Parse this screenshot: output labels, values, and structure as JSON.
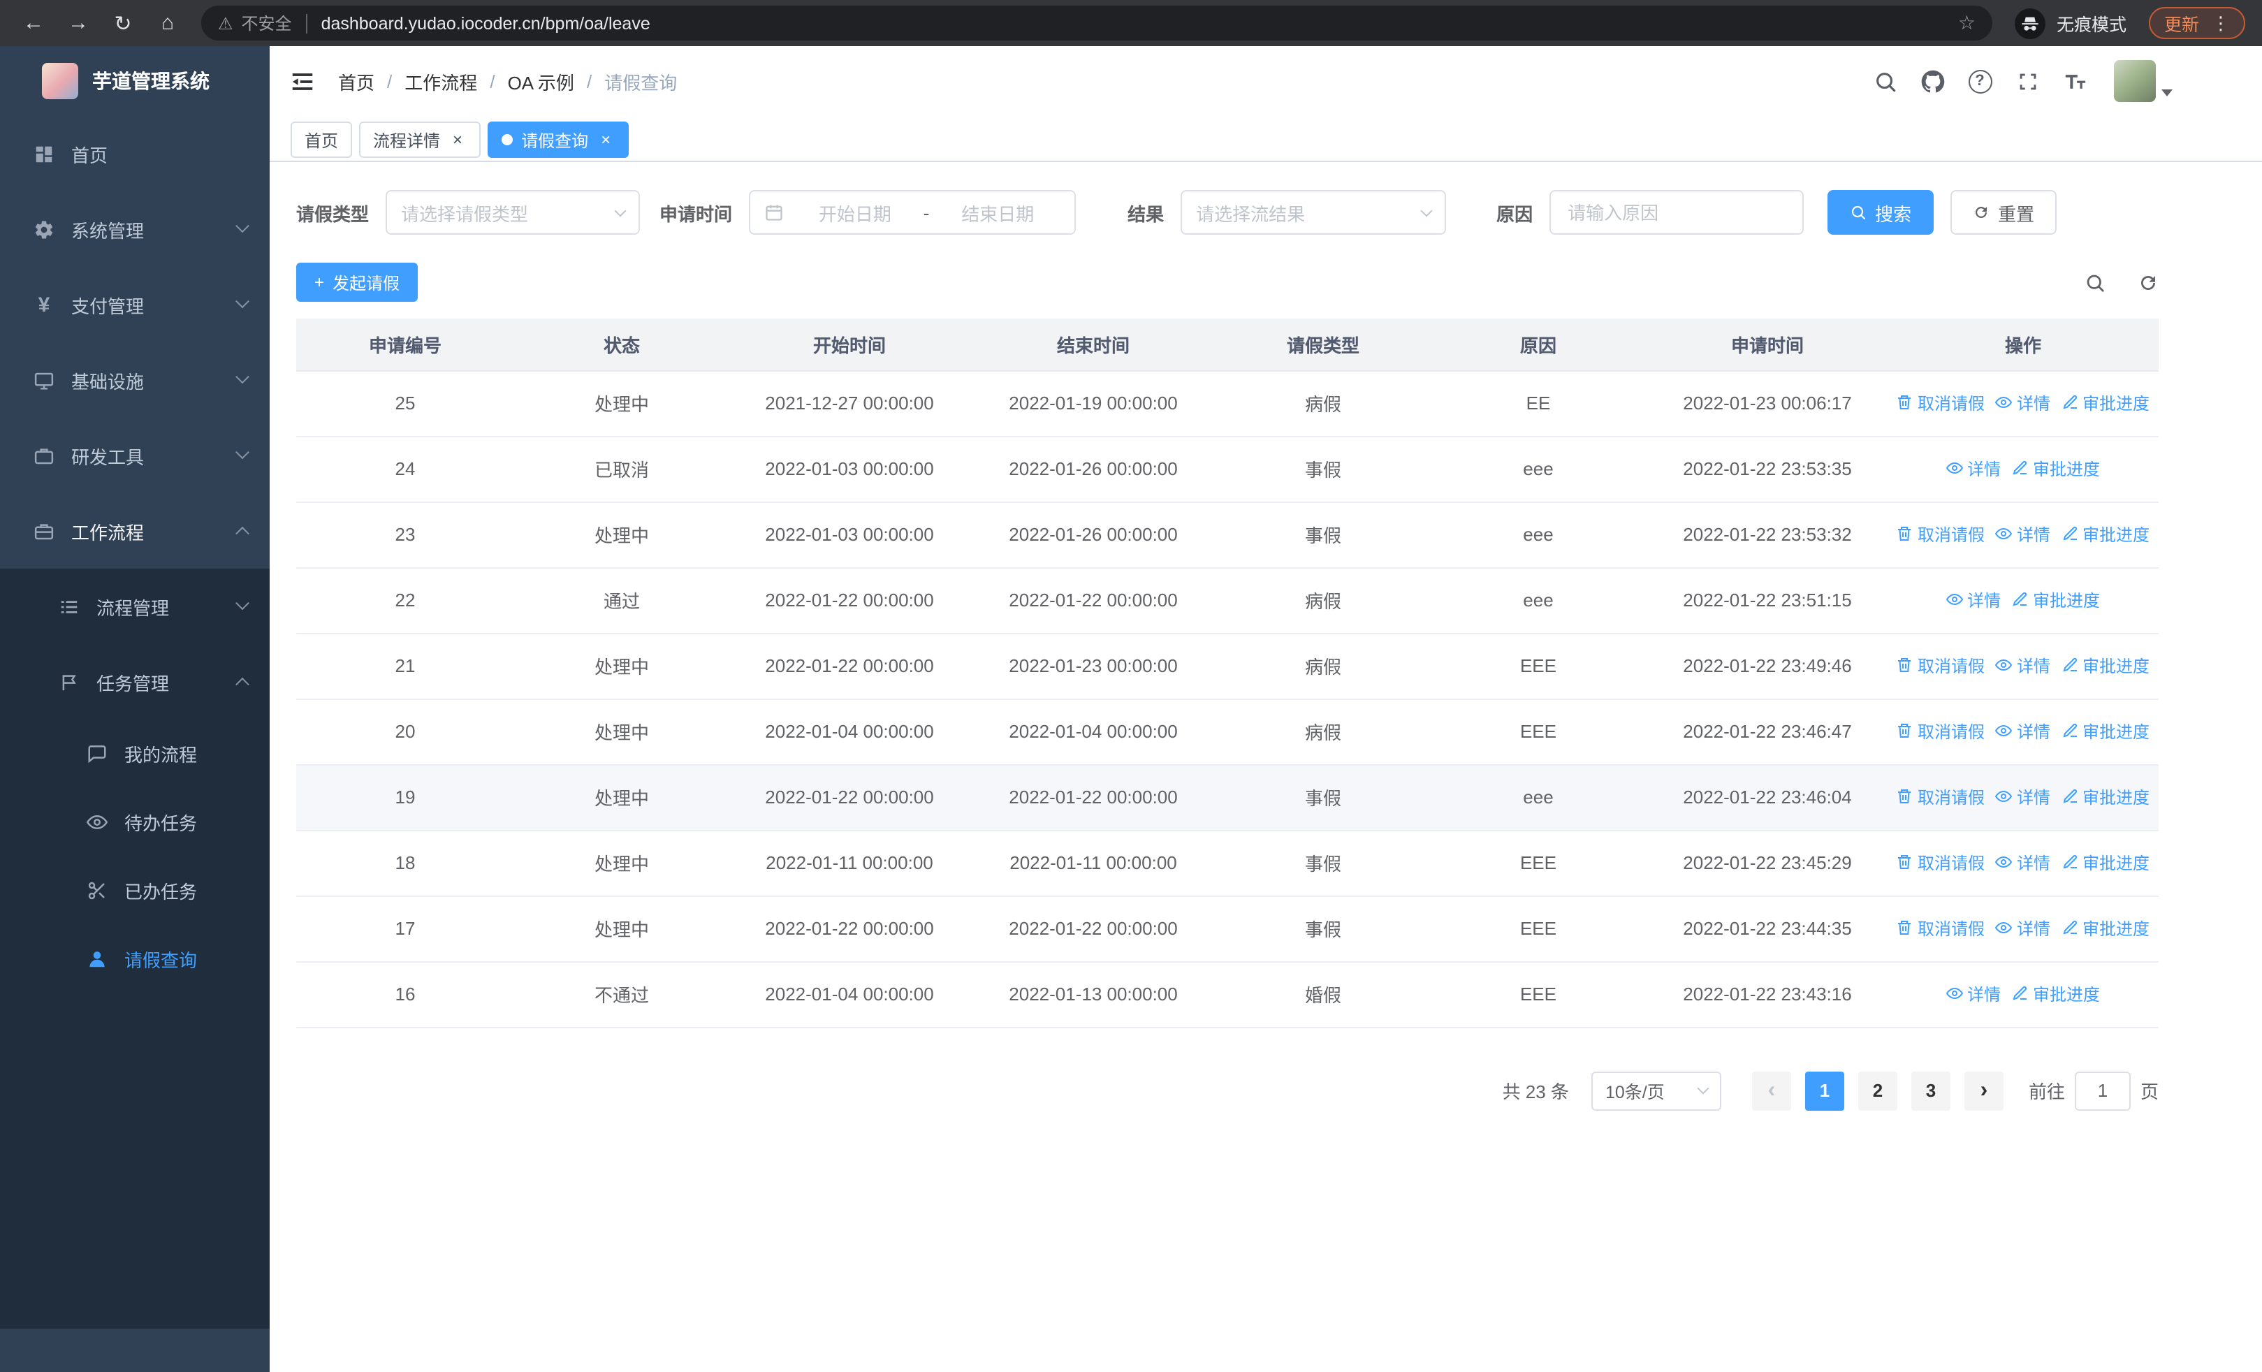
{
  "icons": {
    "back": "←",
    "forward": "→",
    "reload": "↻",
    "home": "⌂",
    "warning": "⚠",
    "star": "☆",
    "dots": "⋮",
    "plus": "+",
    "question": "?",
    "slash": "/",
    "close": "×",
    "prev": "‹",
    "next": "›",
    "yen": "¥"
  },
  "browser": {
    "security_label": "不安全",
    "url": "dashboard.yudao.iocoder.cn/bpm/oa/leave",
    "incognito_label": "无痕模式",
    "update_label": "更新"
  },
  "sidebar": {
    "logo_title": "芋道管理系统",
    "items": [
      {
        "label": "首页",
        "icon": "dashboard-icon"
      },
      {
        "label": "系统管理",
        "icon": "gear-icon"
      },
      {
        "label": "支付管理",
        "icon": "payment-icon"
      },
      {
        "label": "基础设施",
        "icon": "infrastructure-icon"
      },
      {
        "label": "研发工具",
        "icon": "tools-icon"
      },
      {
        "label": "工作流程",
        "icon": "workflow-icon"
      }
    ],
    "sub_items": [
      {
        "label": "流程管理",
        "icon": "process-management-icon"
      },
      {
        "label": "任务管理",
        "icon": "task-management-icon"
      }
    ],
    "task_items": [
      {
        "label": "我的流程",
        "icon": "my-process-icon"
      },
      {
        "label": "待办任务",
        "icon": "todo-tasks-icon"
      },
      {
        "label": "已办任务",
        "icon": "completed-tasks-icon"
      },
      {
        "label": "请假查询",
        "icon": "leave-query-icon"
      }
    ]
  },
  "header": {
    "breadcrumb": [
      "首页",
      "工作流程",
      "OA 示例",
      "请假查询"
    ]
  },
  "tabs": [
    {
      "label": "首页"
    },
    {
      "label": "流程详情"
    },
    {
      "label": "请假查询"
    }
  ],
  "filters": {
    "leave_type_label": "请假类型",
    "leave_type_placeholder": "请选择请假类型",
    "apply_time_label": "申请时间",
    "start_date_placeholder": "开始日期",
    "date_separator": "-",
    "end_date_placeholder": "结束日期",
    "result_label": "结果",
    "result_placeholder": "请选择流结果",
    "reason_label": "原因",
    "reason_placeholder": "请输入原因",
    "search_label": "搜索",
    "reset_label": "重置"
  },
  "toolbar": {
    "create_label": "发起请假"
  },
  "table": {
    "columns": [
      "申请编号",
      "状态",
      "开始时间",
      "结束时间",
      "请假类型",
      "原因",
      "申请时间",
      "操作"
    ],
    "action_labels": {
      "cancel": "取消请假",
      "detail": "详情",
      "progress": "审批进度"
    },
    "rows": [
      {
        "id": "25",
        "status": "处理中",
        "start": "2021-12-27 00:00:00",
        "end": "2022-01-19 00:00:00",
        "type": "病假",
        "reason": "EE",
        "applied": "2022-01-23 00:06:17",
        "actions": [
          "cancel",
          "detail",
          "progress"
        ],
        "highlight": false
      },
      {
        "id": "24",
        "status": "已取消",
        "start": "2022-01-03 00:00:00",
        "end": "2022-01-26 00:00:00",
        "type": "事假",
        "reason": "eee",
        "applied": "2022-01-22 23:53:35",
        "actions": [
          "detail",
          "progress"
        ],
        "highlight": false
      },
      {
        "id": "23",
        "status": "处理中",
        "start": "2022-01-03 00:00:00",
        "end": "2022-01-26 00:00:00",
        "type": "事假",
        "reason": "eee",
        "applied": "2022-01-22 23:53:32",
        "actions": [
          "cancel",
          "detail",
          "progress"
        ],
        "highlight": false
      },
      {
        "id": "22",
        "status": "通过",
        "start": "2022-01-22 00:00:00",
        "end": "2022-01-22 00:00:00",
        "type": "病假",
        "reason": "eee",
        "applied": "2022-01-22 23:51:15",
        "actions": [
          "detail",
          "progress"
        ],
        "highlight": false
      },
      {
        "id": "21",
        "status": "处理中",
        "start": "2022-01-22 00:00:00",
        "end": "2022-01-23 00:00:00",
        "type": "病假",
        "reason": "EEE",
        "applied": "2022-01-22 23:49:46",
        "actions": [
          "cancel",
          "detail",
          "progress"
        ],
        "highlight": false
      },
      {
        "id": "20",
        "status": "处理中",
        "start": "2022-01-04 00:00:00",
        "end": "2022-01-04 00:00:00",
        "type": "病假",
        "reason": "EEE",
        "applied": "2022-01-22 23:46:47",
        "actions": [
          "cancel",
          "detail",
          "progress"
        ],
        "highlight": false
      },
      {
        "id": "19",
        "status": "处理中",
        "start": "2022-01-22 00:00:00",
        "end": "2022-01-22 00:00:00",
        "type": "事假",
        "reason": "eee",
        "applied": "2022-01-22 23:46:04",
        "actions": [
          "cancel",
          "detail",
          "progress"
        ],
        "highlight": true
      },
      {
        "id": "18",
        "status": "处理中",
        "start": "2022-01-11 00:00:00",
        "end": "2022-01-11 00:00:00",
        "type": "事假",
        "reason": "EEE",
        "applied": "2022-01-22 23:45:29",
        "actions": [
          "cancel",
          "detail",
          "progress"
        ],
        "highlight": false
      },
      {
        "id": "17",
        "status": "处理中",
        "start": "2022-01-22 00:00:00",
        "end": "2022-01-22 00:00:00",
        "type": "事假",
        "reason": "EEE",
        "applied": "2022-01-22 23:44:35",
        "actions": [
          "cancel",
          "detail",
          "progress"
        ],
        "highlight": false
      },
      {
        "id": "16",
        "status": "不通过",
        "start": "2022-01-04 00:00:00",
        "end": "2022-01-13 00:00:00",
        "type": "婚假",
        "reason": "EEE",
        "applied": "2022-01-22 23:43:16",
        "actions": [
          "detail",
          "progress"
        ],
        "highlight": false
      }
    ]
  },
  "pagination": {
    "total_label": "共 23 条",
    "page_size": "10条/页",
    "pages": [
      "1",
      "2",
      "3"
    ],
    "active_page": "1",
    "goto_label": "前往",
    "goto_value": "1",
    "goto_suffix": "页"
  },
  "colors": {
    "accent": "#409eff",
    "link": "#409eff",
    "sidebar_bg": "#304156",
    "submenu_bg": "#1f2d3d",
    "active_row_bg": "#f5f7fa",
    "table_header_bg": "#f2f3f5"
  }
}
